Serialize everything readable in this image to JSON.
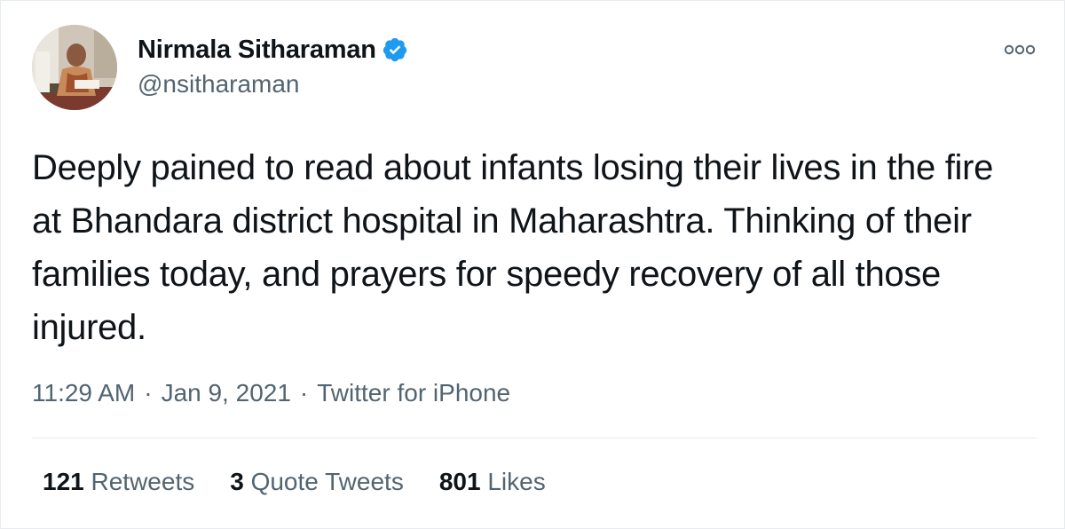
{
  "tweet": {
    "display_name": "Nirmala Sitharaman",
    "handle": "@nsitharaman",
    "verified": true,
    "text": "Deeply pained to read about infants losing their lives in the fire at Bhandara district hospital in Maharashtra. Thinking of their families today, and prayers for speedy recovery of all those injured.",
    "time": "11:29 AM",
    "date": "Jan 9, 2021",
    "source": "Twitter for iPhone",
    "separator": "·"
  },
  "stats": {
    "retweets_count": "121",
    "retweets_label": "Retweets",
    "quote_count": "3",
    "quote_label": "Quote Tweets",
    "likes_count": "801",
    "likes_label": "Likes"
  },
  "icons": {
    "verified": "verified-badge-icon",
    "more": "more-options-icon"
  },
  "colors": {
    "verified_blue": "#1d9bf0",
    "secondary_text": "#536471",
    "primary_text": "#0f1419"
  }
}
